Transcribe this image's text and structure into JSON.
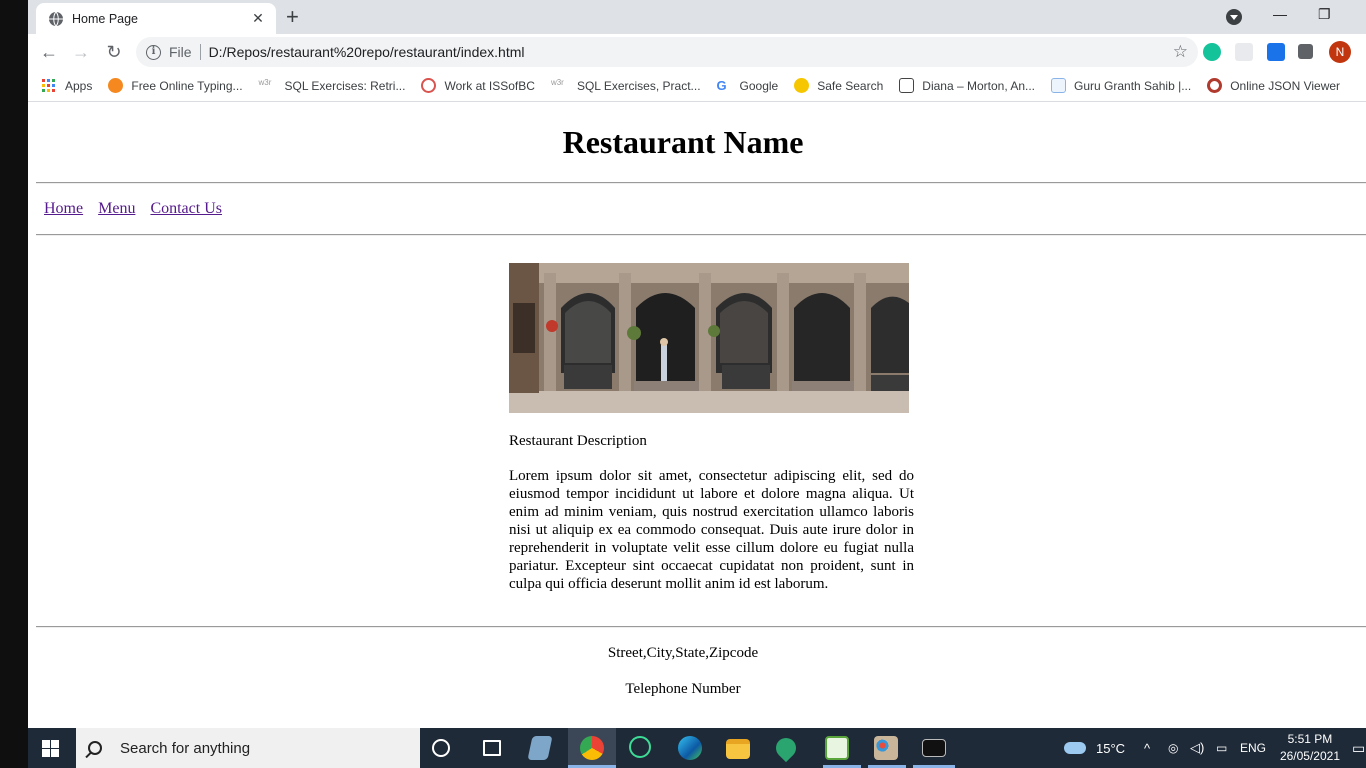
{
  "browser": {
    "tab": {
      "title": "Home Page",
      "close": "✕"
    },
    "new_tab": "+",
    "window_controls": {
      "minimize": "—",
      "restore": "❐"
    },
    "address": {
      "scheme_label": "File",
      "url": "D:/Repos/restaurant%20repo/restaurant/index.html"
    },
    "profile_initial": "N",
    "bookmarks": [
      {
        "label": "Apps",
        "icon": "apps-grid-icon"
      },
      {
        "label": "Free Online Typing...",
        "icon": "typing-icon",
        "color": "#f5891f"
      },
      {
        "label": "SQL Exercises: Retri...",
        "icon": "w3r-icon"
      },
      {
        "label": "Work at ISSofBC",
        "icon": "issofbc-icon"
      },
      {
        "label": "SQL Exercises, Pract...",
        "icon": "w3r-icon"
      },
      {
        "label": "Google",
        "icon": "google-icon"
      },
      {
        "label": "Safe Search",
        "icon": "safe-search-icon"
      },
      {
        "label": "Diana – Morton, An...",
        "icon": "book-icon"
      },
      {
        "label": "Guru Granth Sahib |...",
        "icon": "document-icon"
      },
      {
        "label": "Online JSON Viewer",
        "icon": "json-viewer-icon"
      }
    ]
  },
  "page": {
    "title": "Restaurant Name",
    "nav": [
      "Home",
      "Menu",
      "Contact Us"
    ],
    "description_title": "Restaurant Description",
    "description": "Lorem ipsum dolor sit amet, consectetur adipiscing elit, sed do eiusmod tempor incididunt ut labore et dolore magna aliqua. Ut enim ad minim veniam, quis nostrud exercitation ullamco laboris nisi ut aliquip ex ea commodo consequat. Duis aute irure dolor in reprehenderit in voluptate velit esse cillum dolore eu fugiat nulla pariatur. Excepteur sint occaecat cupidatat non proident, sunt in culpa qui officia deserunt mollit anim id est laborum.",
    "address": "Street,City,State,Zipcode",
    "phone": "Telephone Number"
  },
  "taskbar": {
    "search_placeholder": "Search for anything",
    "weather": "15°C",
    "language": "ENG",
    "time": "5:51 PM",
    "date": "26/05/2021"
  },
  "colors": {
    "link": "#551a8b",
    "taskbar": "#1f2a38",
    "profile": "#c1360f"
  }
}
